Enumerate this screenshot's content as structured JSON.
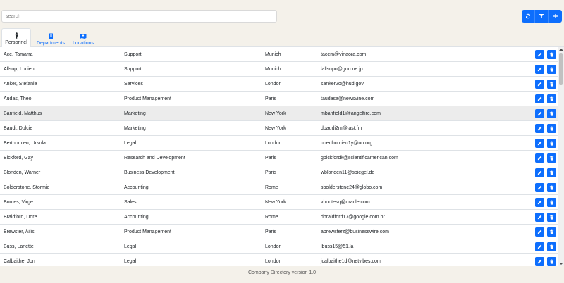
{
  "search": {
    "placeholder": "search"
  },
  "toolbar": {
    "refresh_icon": "refresh-icon",
    "filter_icon": "filter-icon",
    "add_icon": "plus-icon"
  },
  "tabs": [
    {
      "label": "Personnel",
      "icon": "person-icon",
      "active": true
    },
    {
      "label": "Departments",
      "icon": "building-icon",
      "active": false
    },
    {
      "label": "Locations",
      "icon": "map-icon",
      "active": false
    }
  ],
  "rows": [
    {
      "name": "Ace, Tamarra",
      "department": "Support",
      "location": "Munich",
      "email": "tacem@vinaora.com"
    },
    {
      "name": "Allsup, Lucien",
      "department": "Support",
      "location": "Munich",
      "email": "lallsupo@goo.ne.jp"
    },
    {
      "name": "Anker, Stefanie",
      "department": "Services",
      "location": "London",
      "email": "sanker2o@hud.gov"
    },
    {
      "name": "Audas, Theo",
      "department": "Product Management",
      "location": "Paris",
      "email": "taudasa@newsvine.com"
    },
    {
      "name": "Banfield, Matthus",
      "department": "Marketing",
      "location": "New York",
      "email": "mbanfield1i@angelfire.com"
    },
    {
      "name": "Baudi, Dulcie",
      "department": "Marketing",
      "location": "New York",
      "email": "dbaudi2m@last.fm"
    },
    {
      "name": "Berthomieu, Ursola",
      "department": "Legal",
      "location": "London",
      "email": "uberthomieu1y@un.org"
    },
    {
      "name": "Bickford, Gay",
      "department": "Research and Development",
      "location": "Paris",
      "email": "gbickfordk@scientificamerican.com"
    },
    {
      "name": "Blonden, Warner",
      "department": "Business Development",
      "location": "Paris",
      "email": "wblonden11@spiegel.de"
    },
    {
      "name": "Bolderstone, Stormie",
      "department": "Accounting",
      "location": "Rome",
      "email": "sbolderstone24@globo.com"
    },
    {
      "name": "Bootes, Virge",
      "department": "Sales",
      "location": "New York",
      "email": "vbootesq@oracle.com"
    },
    {
      "name": "Braidford, Dore",
      "department": "Accounting",
      "location": "Rome",
      "email": "dbraidford17@google.com.br"
    },
    {
      "name": "Brewster, Ailis",
      "department": "Product Management",
      "location": "Paris",
      "email": "abrewsterz@businesswire.com"
    },
    {
      "name": "Buss, Lanette",
      "department": "Legal",
      "location": "London",
      "email": "lbuss15@51.la"
    },
    {
      "name": "Calbaithe, Jon",
      "department": "Legal",
      "location": "London",
      "email": "jcalbaithe1d@netvibes.com"
    }
  ],
  "row_actions": {
    "edit_icon": "pencil-icon",
    "delete_icon": "trash-icon"
  },
  "footer": {
    "text": "Company Directory version 1.0"
  }
}
